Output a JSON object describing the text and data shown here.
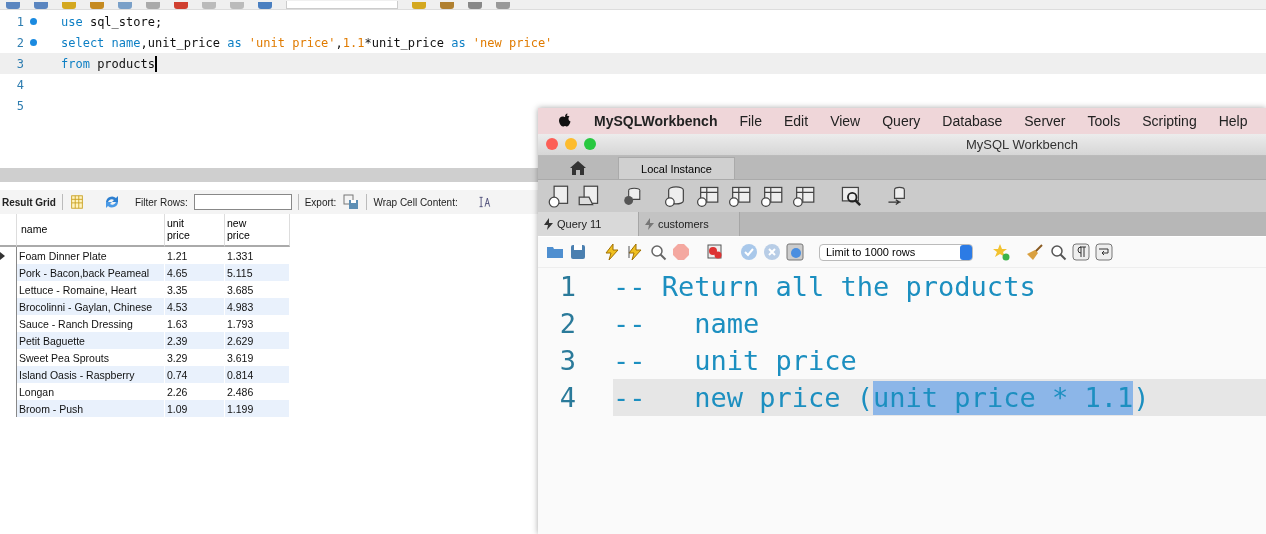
{
  "back_editor": {
    "lines": [
      {
        "number": "1",
        "marker": true,
        "current": false,
        "tokens": [
          {
            "kind": "keyword",
            "text": "use"
          },
          {
            "kind": "plain",
            "text": " sql_store;"
          }
        ]
      },
      {
        "number": "2",
        "marker": true,
        "current": false,
        "tokens": [
          {
            "kind": "keyword",
            "text": "select"
          },
          {
            "kind": "keyword",
            "text": " name"
          },
          {
            "kind": "plain",
            "text": ",unit_price "
          },
          {
            "kind": "keyword",
            "text": "as"
          },
          {
            "kind": "string",
            "text": " 'unit price'"
          },
          {
            "kind": "plain",
            "text": ","
          },
          {
            "kind": "number",
            "text": "1.1"
          },
          {
            "kind": "plain",
            "text": "*unit_price "
          },
          {
            "kind": "keyword",
            "text": "as"
          },
          {
            "kind": "string",
            "text": " 'new price'"
          }
        ]
      },
      {
        "number": "3",
        "marker": false,
        "current": true,
        "tokens": [
          {
            "kind": "keyword",
            "text": "from"
          },
          {
            "kind": "plain",
            "text": " products"
          }
        ]
      },
      {
        "number": "4",
        "marker": false,
        "current": false
      },
      {
        "number": "5",
        "marker": false,
        "current": false
      }
    ]
  },
  "result_toolbar": {
    "title": "Result Grid",
    "filter_label": "Filter Rows:",
    "export_label": "Export:",
    "wrap_label": "Wrap Cell Content:"
  },
  "result_table": {
    "columns": [
      "name",
      "unit\nprice",
      "new\nprice"
    ],
    "rows": [
      {
        "current": true,
        "cells": [
          "Foam Dinner Plate",
          "1.21",
          "1.331"
        ]
      },
      {
        "current": false,
        "cells": [
          "Pork - Bacon,back Peameal",
          "4.65",
          "5.115"
        ]
      },
      {
        "current": false,
        "cells": [
          "Lettuce - Romaine, Heart",
          "3.35",
          "3.685"
        ]
      },
      {
        "current": false,
        "cells": [
          "Brocolinni - Gaylan, Chinese",
          "4.53",
          "4.983"
        ]
      },
      {
        "current": false,
        "cells": [
          "Sauce - Ranch Dressing",
          "1.63",
          "1.793"
        ]
      },
      {
        "current": false,
        "cells": [
          "Petit Baguette",
          "2.39",
          "2.629"
        ]
      },
      {
        "current": false,
        "cells": [
          "Sweet Pea Sprouts",
          "3.29",
          "3.619"
        ]
      },
      {
        "current": false,
        "cells": [
          "Island Oasis - Raspberry",
          "0.74",
          "0.814"
        ]
      },
      {
        "current": false,
        "cells": [
          "Longan",
          "2.26",
          "2.486"
        ]
      },
      {
        "current": false,
        "cells": [
          "Broom - Push",
          "1.09",
          "1.199"
        ]
      }
    ]
  },
  "mac_window": {
    "menu_bar": {
      "app": "MySQLWorkbench",
      "items": [
        "File",
        "Edit",
        "View",
        "Query",
        "Database",
        "Server",
        "Tools",
        "Scripting",
        "Help"
      ]
    },
    "title": "MySQL Workbench",
    "connection_tabs": [
      {
        "label": "Local Instance",
        "selected": true
      }
    ],
    "query_tabs": [
      {
        "label": "Query 11",
        "selected": true
      },
      {
        "label": "customers",
        "selected": false
      }
    ],
    "limit_dropdown": {
      "value": "Limit to 1000 rows"
    },
    "editor": {
      "lines": [
        {
          "number": "1",
          "current": false,
          "segments": [
            {
              "text": "-- Return all the products",
              "selected": false
            }
          ]
        },
        {
          "number": "2",
          "current": false,
          "segments": [
            {
              "text": "--   name",
              "selected": false
            }
          ]
        },
        {
          "number": "3",
          "current": false,
          "segments": [
            {
              "text": "--   unit price",
              "selected": false
            }
          ]
        },
        {
          "number": "4",
          "current": true,
          "segments": [
            {
              "text": "--   new price (",
              "selected": false
            },
            {
              "text": "unit price * 1.1",
              "selected": true
            },
            {
              "text": ")",
              "selected": false
            }
          ]
        }
      ]
    }
  }
}
